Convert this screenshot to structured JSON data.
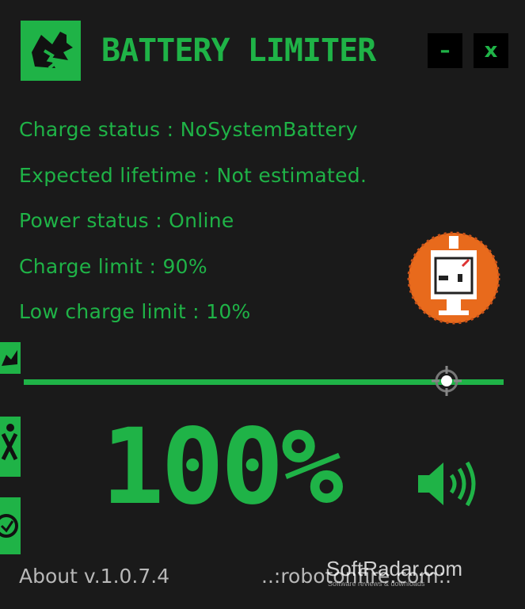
{
  "app": {
    "title": "BATTERY LIMITER",
    "minimize_label": "–",
    "close_label": "x"
  },
  "info": {
    "charge_status": "Charge status : NoSystemBattery",
    "expected_lifetime": "Expected lifetime : Not estimated.",
    "power_status": "Power status : Online",
    "charge_limit": "Charge limit : 90%",
    "low_charge_limit": "Low charge limit : 10%"
  },
  "slider": {
    "value_percent": 90
  },
  "battery": {
    "percent_text": "100%"
  },
  "footer": {
    "about": "About  v.1.0.7.4",
    "link": "..:robotonfire.com:."
  },
  "watermark": {
    "text": "SoftRadar.com",
    "subtext": "Software reviews & downloads"
  },
  "icons": {
    "logo": "battery-limiter-logo-icon",
    "avatar": "robot-on-fire-avatar-icon",
    "side_tab_1": "leaf-icon",
    "side_tab_2": "tools-icon",
    "side_tab_3": "badge-icon",
    "slider_thumb": "crosshair-icon",
    "speaker": "speaker-volume-icon"
  },
  "colors": {
    "background": "#1a1a1a",
    "accent": "#1fb347",
    "footer_text": "#b8b8b8",
    "avatar": "#e86a1c"
  }
}
